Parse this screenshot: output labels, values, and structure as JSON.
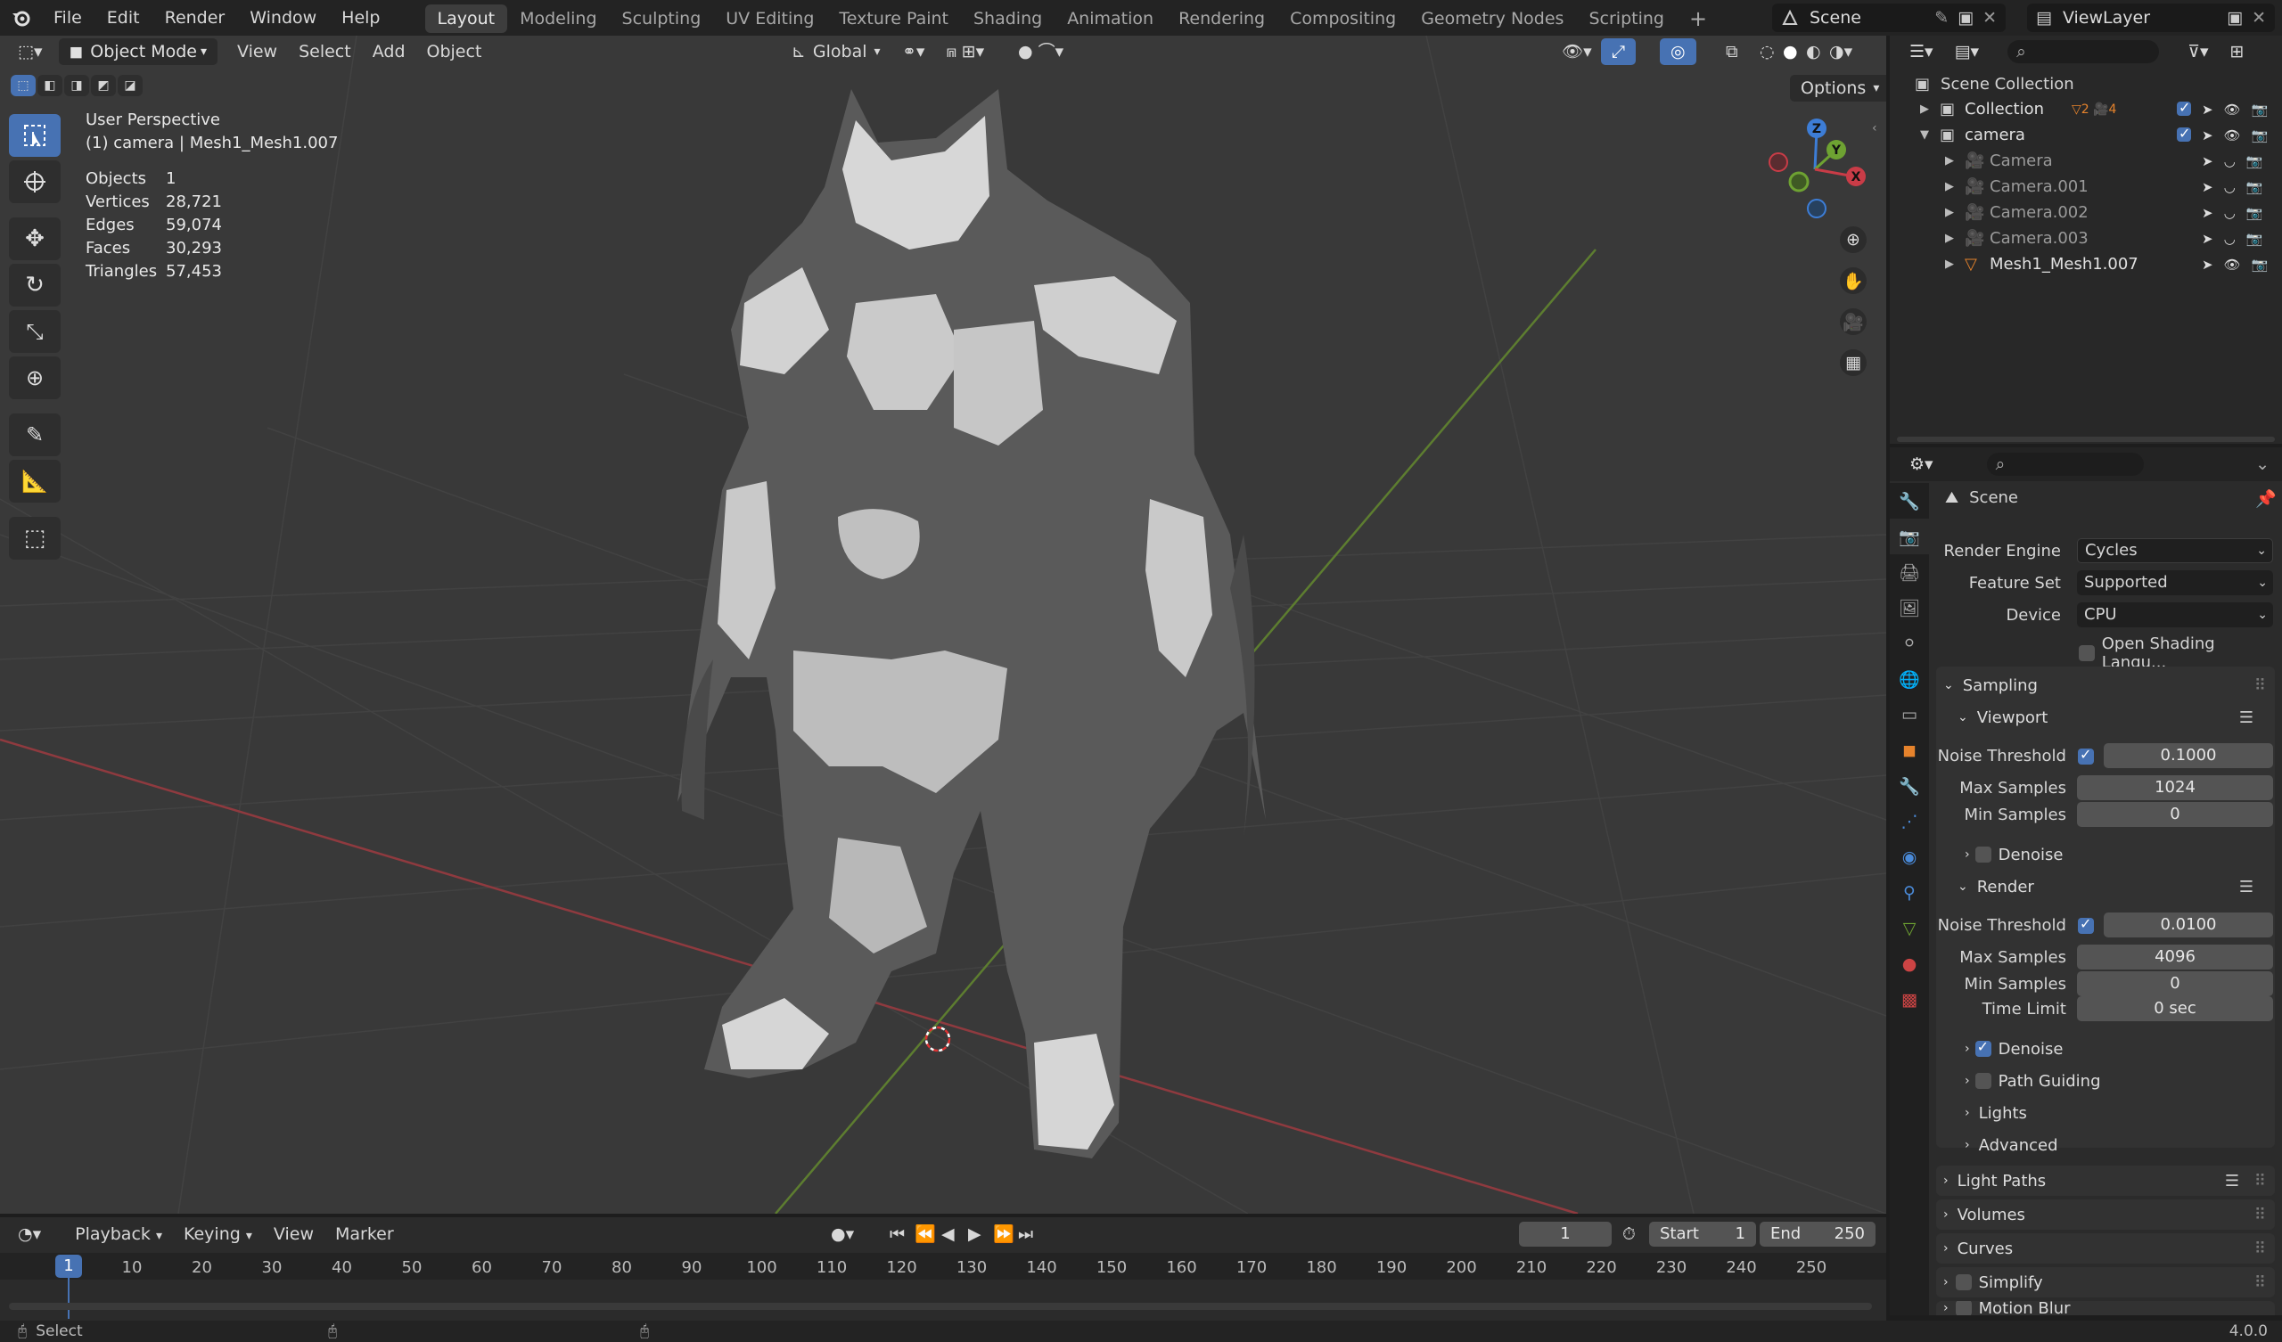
{
  "menu": [
    "File",
    "Edit",
    "Render",
    "Window",
    "Help"
  ],
  "workspaces": [
    "Layout",
    "Modeling",
    "Sculpting",
    "UV Editing",
    "Texture Paint",
    "Shading",
    "Animation",
    "Rendering",
    "Compositing",
    "Geometry Nodes",
    "Scripting"
  ],
  "scene_name": "Scene",
  "view_layer": "ViewLayer",
  "viewport": {
    "mode": "Object Mode",
    "menus": [
      "View",
      "Select",
      "Add",
      "Object"
    ],
    "transform_orientation": "Global",
    "options_label": "Options",
    "view_name": "User Perspective",
    "active_label": "(1) camera | Mesh1_Mesh1.007",
    "stats": [
      {
        "k": "Objects",
        "v": "1"
      },
      {
        "k": "Vertices",
        "v": "28,721"
      },
      {
        "k": "Edges",
        "v": "59,074"
      },
      {
        "k": "Faces",
        "v": "30,293"
      },
      {
        "k": "Triangles",
        "v": "57,453"
      }
    ],
    "gizmo": {
      "x": "X",
      "y": "Y",
      "z": "Z"
    }
  },
  "outliner": {
    "root": "Scene Collection",
    "rows": [
      {
        "label": "Collection",
        "indent": 1,
        "expanded": false
      },
      {
        "label": "camera",
        "indent": 1,
        "expanded": true
      },
      {
        "label": "Camera",
        "indent": 2,
        "expanded": false
      },
      {
        "label": "Camera.001",
        "indent": 2,
        "expanded": false
      },
      {
        "label": "Camera.002",
        "indent": 2,
        "expanded": false
      },
      {
        "label": "Camera.003",
        "indent": 2,
        "expanded": false
      },
      {
        "label": "Mesh1_Mesh1.007",
        "indent": 2,
        "expanded": false
      }
    ],
    "collection_badges": [
      "2",
      "4"
    ]
  },
  "properties": {
    "context": "Scene",
    "render_engine_label": "Render Engine",
    "render_engine": "Cycles",
    "feature_set_label": "Feature Set",
    "feature_set": "Supported",
    "device_label": "Device",
    "device": "CPU",
    "osl_label": "Open Shading Langu...",
    "sampling": "Sampling",
    "viewport_label": "Viewport",
    "vp_noise_label": "Noise Threshold",
    "vp_noise": "0.1000",
    "vp_max_label": "Max Samples",
    "vp_max": "1024",
    "vp_min_label": "Min Samples",
    "vp_min": "0",
    "vp_denoise": "Denoise",
    "render_label": "Render",
    "r_noise_label": "Noise Threshold",
    "r_noise": "0.0100",
    "r_max_label": "Max Samples",
    "r_max": "4096",
    "r_min_label": "Min Samples",
    "r_min": "0",
    "r_time_label": "Time Limit",
    "r_time": "0 sec",
    "r_denoise": "Denoise",
    "path_guiding": "Path Guiding",
    "lights": "Lights",
    "advanced": "Advanced",
    "light_paths": "Light Paths",
    "volumes": "Volumes",
    "curves": "Curves",
    "simplify": "Simplify",
    "motion_blur": "Motion Blur"
  },
  "timeline": {
    "menus": [
      "Playback",
      "Keying",
      "View",
      "Marker"
    ],
    "current_frame": "1",
    "start_label": "Start",
    "start": "1",
    "end_label": "End",
    "end": "250",
    "ticks": [
      "10",
      "20",
      "30",
      "40",
      "50",
      "60",
      "70",
      "80",
      "90",
      "100",
      "110",
      "120",
      "130",
      "140",
      "150",
      "160",
      "170",
      "180",
      "190",
      "200",
      "210",
      "220",
      "230",
      "240",
      "250"
    ],
    "cursor_label": "1"
  },
  "status": {
    "select": "Select",
    "version": "4.0.0"
  },
  "colors": {
    "accent": "#4772b3",
    "x_axis": "#c93c47",
    "y_axis": "#6ea232",
    "z_axis": "#3d7dd6"
  }
}
